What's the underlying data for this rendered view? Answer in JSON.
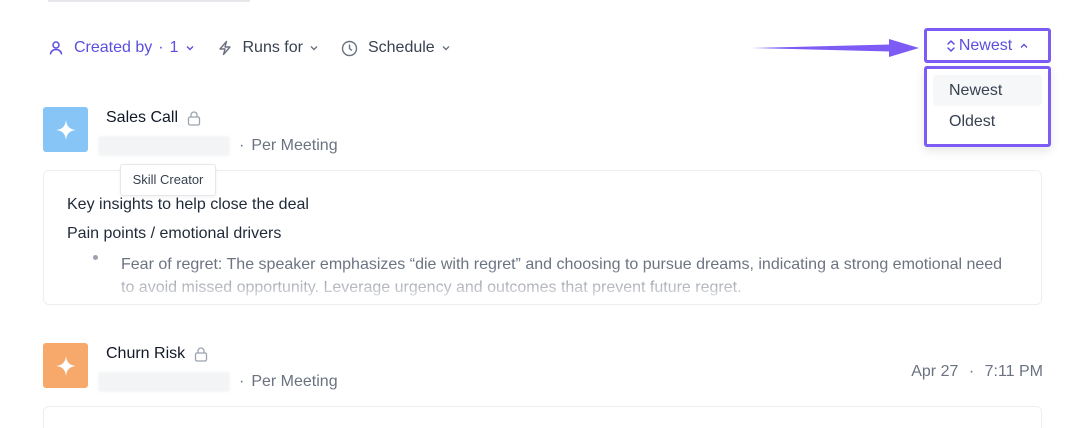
{
  "filters": {
    "created_by": {
      "label": "Created by",
      "separator": "·",
      "count": "1"
    },
    "runs_for": {
      "label": "Runs for"
    },
    "schedule": {
      "label": "Schedule"
    }
  },
  "sort": {
    "current": "Newest",
    "options": [
      "Newest",
      "Oldest"
    ]
  },
  "tooltip": "Skill Creator",
  "cards": [
    {
      "title": "Sales Call",
      "frequency": "Per Meeting",
      "separator": "·",
      "icon": "sparkle-icon",
      "color": "#86c5f6",
      "body": {
        "heading": "Key insights to help close the deal",
        "subheading": "Pain points / emotional drivers",
        "bullets": [
          "Fear of regret: The speaker emphasizes “die with regret” and choosing to pursue dreams, indicating a strong emotional need to avoid missed opportunity. Leverage urgency and outcomes that prevent future regret."
        ]
      }
    },
    {
      "title": "Churn Risk",
      "frequency": "Per Meeting",
      "separator": "·",
      "date": "Apr 27",
      "time": "7:11 PM",
      "icon": "sparkle-icon",
      "color": "#f6a96b"
    }
  ],
  "colors": {
    "accent": "#7c5cf5",
    "accent_text": "#5b4ee0",
    "annotation_arrow": "#7c5cf5"
  }
}
